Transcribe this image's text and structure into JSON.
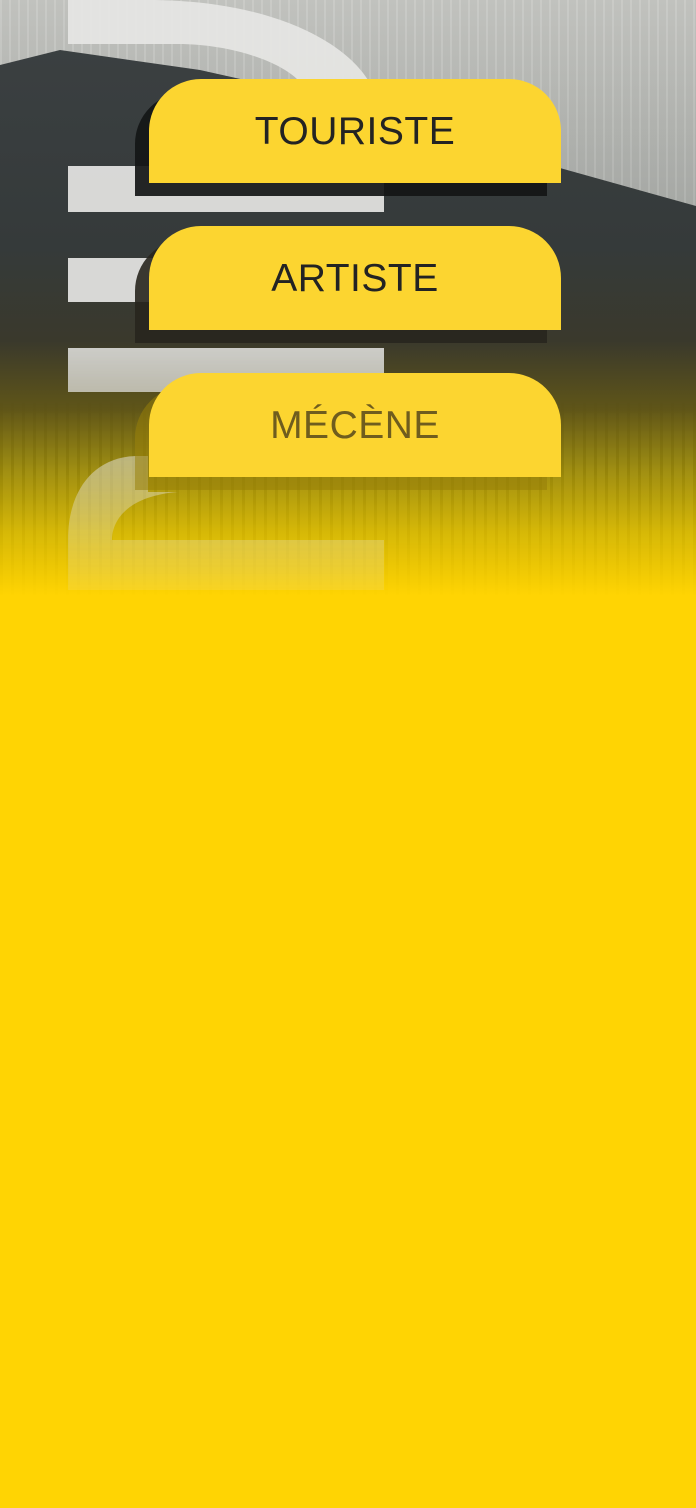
{
  "roles": [
    {
      "label": "TOURISTE"
    },
    {
      "label": "ARTISTE"
    },
    {
      "label": "MÉCÈNE"
    }
  ],
  "colors": {
    "background_accent": "#ffd403",
    "button_fill": "#fcd530",
    "button_shadow": "#141616",
    "button_text": "#232323",
    "button_text_faded": "#6f5d1e",
    "logo_mark": "#e6e6e4"
  },
  "icons": {
    "logo_mark": "brand-logo-mark"
  }
}
